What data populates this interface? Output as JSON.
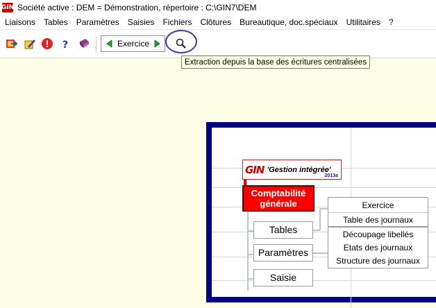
{
  "title": "Société active : DEM = Démonstration, répertoire : C:\\GIN7\\DEM",
  "app_logo": "GIN",
  "menu": [
    "Liaisons",
    "Tables",
    "Paramètres",
    "Saisies",
    "Fichiers",
    "Clôtures",
    "Bureautique, doc.spéciaux",
    "Utilitaires",
    "?"
  ],
  "toolbar": {
    "icons": [
      "exit-icon",
      "edit-icon",
      "alert-icon",
      "help-icon",
      "book-icon"
    ],
    "nav_label": "Exercice",
    "tooltip": "Extraction depuis la base des écritures centralisées"
  },
  "logo": {
    "mark": "GIN",
    "text": "'Gestion intégrée'",
    "year": "2013a"
  },
  "module": {
    "title": "Comptabilité générale",
    "buttons": [
      "Tables",
      "Paramètres",
      "Saisie"
    ]
  },
  "right_panel": {
    "group1": [
      "Exercice",
      "Table des journaux"
    ],
    "group2": [
      "Découpage libellés",
      "Etats des journaux",
      "Structure des journaux"
    ]
  },
  "colors": {
    "frame": "#000080",
    "module_bg": "#ff0000",
    "highlight_circle": "#3a3aa6",
    "workspace": "#fefde6"
  }
}
